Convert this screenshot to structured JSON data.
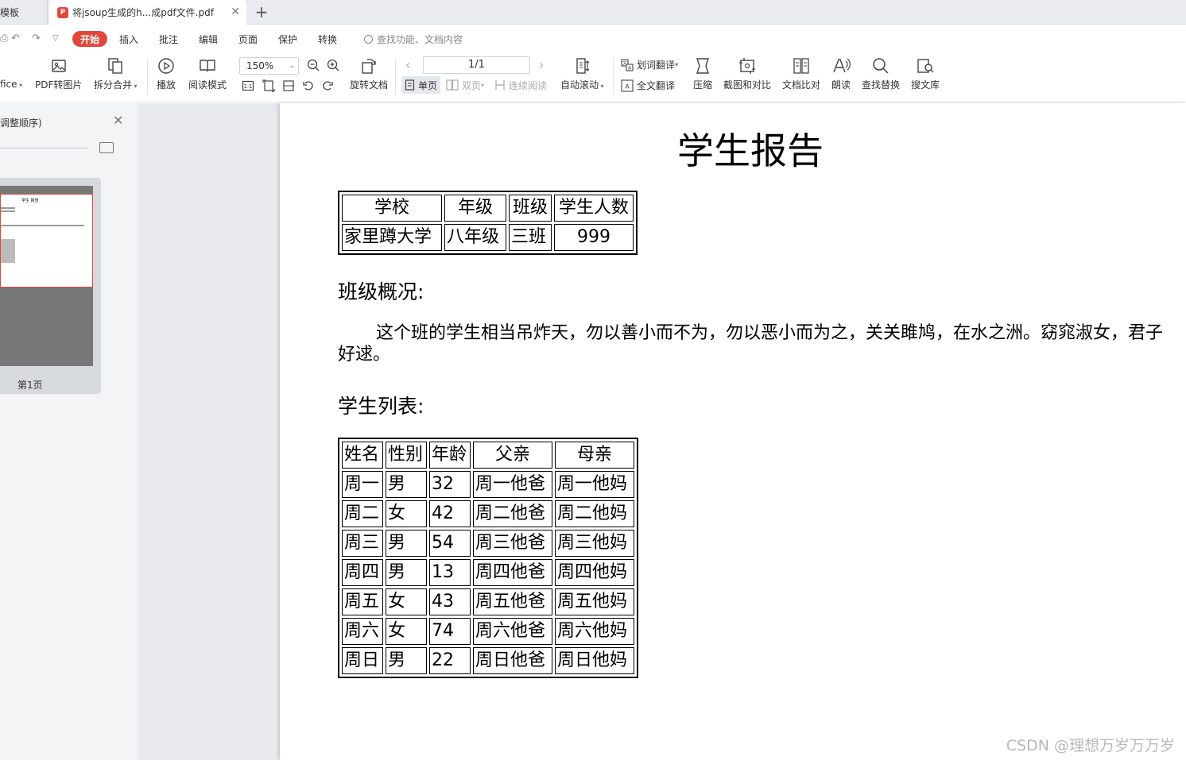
{
  "tabs": {
    "inactive_label": "模板",
    "active_label": "将jsoup生成的h...成pdf文件.pdf"
  },
  "menu": {
    "start": "开始",
    "items": [
      "插入",
      "批注",
      "编辑",
      "页面",
      "保护",
      "转换"
    ],
    "search_placeholder": "查找功能、文档内容"
  },
  "toolbar": {
    "office_label": "fice",
    "pdf_to_image": "PDF转图片",
    "split_merge": "拆分合并",
    "play": "播放",
    "read_mode": "阅读模式",
    "zoom_value": "150%",
    "rotate_doc": "旋转文档",
    "page_indicator": "1/1",
    "single_page": "单页",
    "double_page": "双页",
    "continuous": "连续阅读",
    "auto_scroll": "自动滚动",
    "word_translate": "划词翻译",
    "full_translate": "全文翻译",
    "compress": "压缩",
    "screenshot_compare": "截图和对比",
    "doc_compare": "文档比对",
    "read_aloud": "朗读",
    "find_replace": "查找替换",
    "search_library": "搜文库"
  },
  "left_panel": {
    "title": "调整顺序)",
    "thumb_title": "学生 报告",
    "page_label": "第1页"
  },
  "document": {
    "title": "学生报告",
    "school_table": {
      "headers": [
        "学校",
        "年级",
        "班级",
        "学生人数"
      ],
      "row": [
        "家里蹲大学",
        "八年级",
        "三班",
        "999"
      ]
    },
    "overview_heading": "班级概况:",
    "overview_text": "这个班的学生相当吊炸天，勿以善小而不为，勿以恶小而为之，关关雎鸠，在水之洲。窈窕淑女，君子好逑。",
    "list_heading": "学生列表:",
    "student_table": {
      "headers": [
        "姓名",
        "性别",
        "年龄",
        "父亲",
        "母亲"
      ],
      "rows": [
        [
          "周一",
          "男",
          "32",
          "周一他爸",
          "周一他妈"
        ],
        [
          "周二",
          "女",
          "42",
          "周二他爸",
          "周二他妈"
        ],
        [
          "周三",
          "男",
          "54",
          "周三他爸",
          "周三他妈"
        ],
        [
          "周四",
          "男",
          "13",
          "周四他爸",
          "周四他妈"
        ],
        [
          "周五",
          "女",
          "43",
          "周五他爸",
          "周五他妈"
        ],
        [
          "周六",
          "女",
          "74",
          "周六他爸",
          "周六他妈"
        ],
        [
          "周日",
          "男",
          "22",
          "周日他爸",
          "周日他妈"
        ]
      ]
    }
  },
  "watermark": "CSDN @理想万岁万万岁"
}
